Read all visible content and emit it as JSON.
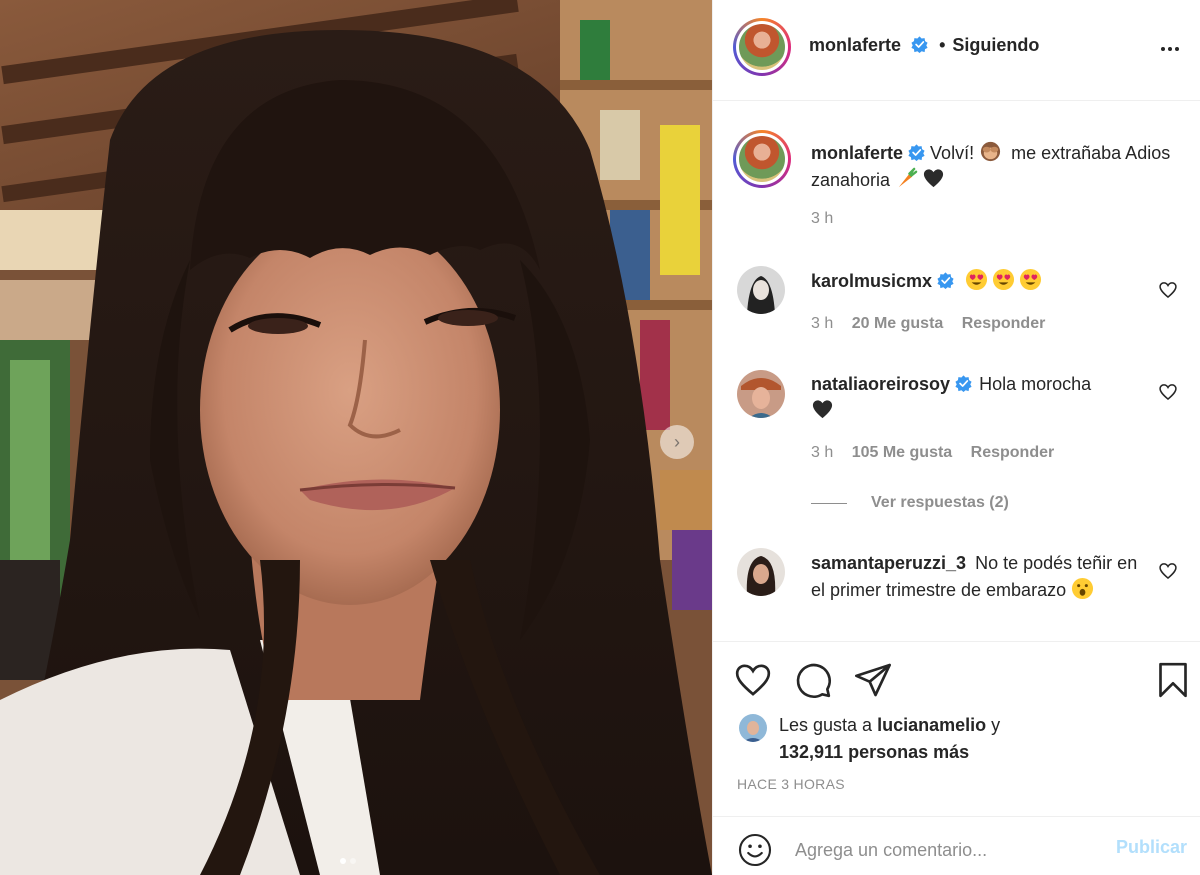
{
  "post": {
    "author": "monlaferte",
    "follow_separator": "•",
    "follow_state": "Siguiendo",
    "more_options_icon": "more-horizontal-icon",
    "carousel": {
      "slide_count": 2,
      "active_slide": 1,
      "next_icon": "chevron-right-icon"
    }
  },
  "caption": {
    "username": "monlaferte",
    "text_part1": "Volví!",
    "emoji1": "see-no-evil-monkey-emoji",
    "text_part2": "me extrañaba Adios zanahoria",
    "emoji2": "carrot-emoji",
    "emoji3": "black-heart-emoji",
    "time": "3 h"
  },
  "comments": [
    {
      "username": "karolmusicmx",
      "verified": true,
      "text": "",
      "emojis": [
        "heart-eyes-emoji",
        "heart-eyes-emoji",
        "heart-eyes-emoji"
      ],
      "time": "3 h",
      "likes": "20 Me gusta",
      "reply": "Responder"
    },
    {
      "username": "nataliaoreirosoy",
      "verified": true,
      "text": "Hola morocha",
      "emojis": [
        "black-heart-emoji"
      ],
      "time": "3 h",
      "likes": "105 Me gusta",
      "reply": "Responder",
      "view_replies": "Ver respuestas (2)"
    },
    {
      "username": "samantaperuzzi_3",
      "verified": false,
      "text": "No te podés teñir en el primer trimestre de embarazo",
      "emojis": [
        "astonished-face-emoji"
      ]
    }
  ],
  "actions": {
    "like_icon": "heart-icon",
    "comment_icon": "comment-icon",
    "share_icon": "paper-plane-icon",
    "save_icon": "bookmark-icon"
  },
  "likes": {
    "prefix": "Les gusta a",
    "user": "lucianamelio",
    "connector": "y",
    "count": "132,911 personas más"
  },
  "timestamp": "HACE 3 HORAS",
  "add_comment": {
    "smiley_icon": "smiley-icon",
    "placeholder": "Agrega un comentario...",
    "publish": "Publicar"
  },
  "colors": {
    "text": "#262626",
    "muted": "#8e8e8e",
    "border": "#efefef",
    "verified": "#3897f0",
    "publish_disabled": "#b2dffc"
  }
}
